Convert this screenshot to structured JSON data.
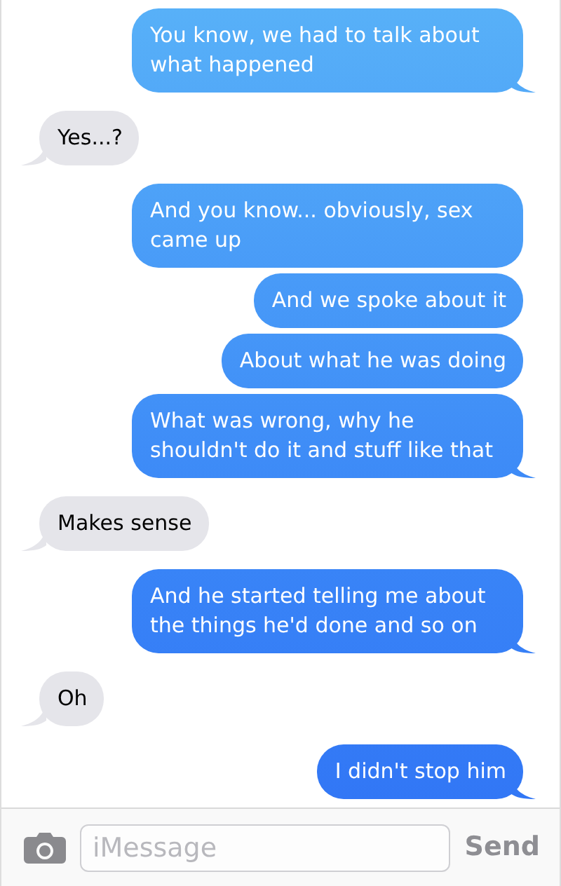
{
  "messages": [
    {
      "kind": "sent",
      "text": "You know, we had to talk about what happened"
    },
    {
      "kind": "received",
      "text": "Yes...?"
    },
    {
      "kind": "sent",
      "text": "And you know... obviously, sex came up"
    },
    {
      "kind": "sent",
      "text": "And we spoke about it"
    },
    {
      "kind": "sent",
      "text": "About what he was doing"
    },
    {
      "kind": "sent",
      "text": "What was wrong, why he shouldn't do it and stuff like that"
    },
    {
      "kind": "received",
      "text": "Makes sense"
    },
    {
      "kind": "sent",
      "text": "And he started telling me about the things he'd done and so on"
    },
    {
      "kind": "received",
      "text": "Oh"
    },
    {
      "kind": "sent",
      "text": "I didn't stop him"
    }
  ],
  "composer": {
    "placeholder": "iMessage",
    "send": "Send"
  }
}
